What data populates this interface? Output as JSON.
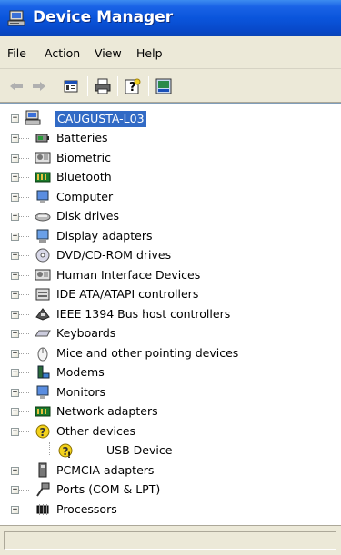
{
  "window": {
    "title": "Device Manager"
  },
  "menu": [
    "File",
    "Action",
    "View",
    "Help"
  ],
  "toolbar": {
    "buttons": [
      "back-arrow-icon",
      "forward-arrow-icon",
      "properties-icon",
      "print-icon",
      "help-icon",
      "scan-hardware-icon"
    ]
  },
  "tree": {
    "root": {
      "label": "CAUGUSTA-L03",
      "icon": "computer-icon"
    },
    "items": [
      {
        "label": "Batteries",
        "icon": "battery-icon"
      },
      {
        "label": "Biometric",
        "icon": "biometric-icon"
      },
      {
        "label": "Bluetooth",
        "icon": "bluetooth-icon"
      },
      {
        "label": "Computer",
        "icon": "monitor-icon"
      },
      {
        "label": "Disk drives",
        "icon": "disk-drive-icon"
      },
      {
        "label": "Display adapters",
        "icon": "display-adapter-icon"
      },
      {
        "label": "DVD/CD-ROM drives",
        "icon": "cd-drive-icon"
      },
      {
        "label": "Human Interface Devices",
        "icon": "hid-icon"
      },
      {
        "label": "IDE ATA/ATAPI controllers",
        "icon": "ide-controller-icon"
      },
      {
        "label": "IEEE 1394 Bus host controllers",
        "icon": "ieee1394-icon"
      },
      {
        "label": "Keyboards",
        "icon": "keyboard-icon"
      },
      {
        "label": "Mice and other pointing devices",
        "icon": "mouse-icon"
      },
      {
        "label": "Modems",
        "icon": "modem-icon"
      },
      {
        "label": "Monitors",
        "icon": "monitor-icon"
      },
      {
        "label": "Network adapters",
        "icon": "network-adapter-icon"
      },
      {
        "label": "Other devices",
        "icon": "unknown-device-icon",
        "expanded": true
      },
      {
        "label": "USB Device",
        "icon": "unknown-device-warning-icon",
        "child": true
      },
      {
        "label": "PCMCIA adapters",
        "icon": "pcmcia-icon"
      },
      {
        "label": "Ports (COM & LPT)",
        "icon": "port-icon"
      },
      {
        "label": "Processors",
        "icon": "processor-icon"
      }
    ]
  },
  "colors": {
    "titlebar": "#0a55dc",
    "selection": "#316ac5",
    "chrome": "#ece9d8"
  }
}
